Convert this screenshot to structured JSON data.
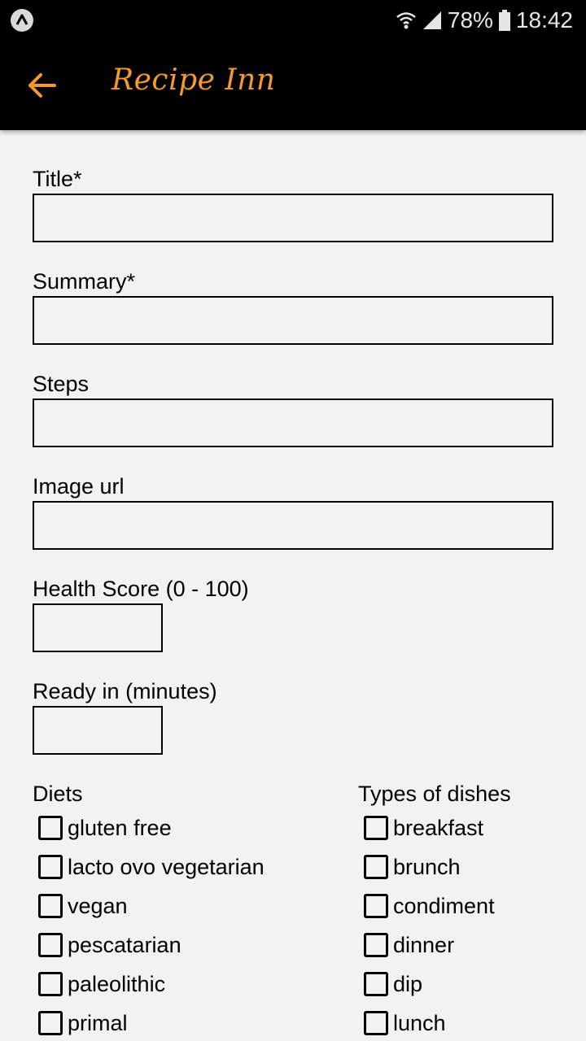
{
  "status_bar": {
    "app_icon": "app-launcher-icon",
    "battery_percent": "78%",
    "time": "18:42",
    "icons": [
      "wifi-icon",
      "signal-icon",
      "battery-icon"
    ]
  },
  "app_bar": {
    "back_icon": "arrow-left-icon",
    "title": "Recipe Inn",
    "accent_color": "#f39a2b"
  },
  "form": {
    "title_label": "Title*",
    "title_value": "",
    "summary_label": "Summary*",
    "summary_value": "",
    "steps_label": "Steps",
    "steps_value": "",
    "image_url_label": "Image url",
    "image_url_value": "",
    "health_score_label": "Health Score (0 - 100)",
    "health_score_value": "",
    "ready_in_label": "Ready in (minutes)",
    "ready_in_value": ""
  },
  "diets": {
    "heading": "Diets",
    "items": [
      {
        "label": "gluten free",
        "checked": false
      },
      {
        "label": "lacto ovo vegetarian",
        "checked": false
      },
      {
        "label": "vegan",
        "checked": false
      },
      {
        "label": "pescatarian",
        "checked": false
      },
      {
        "label": "paleolithic",
        "checked": false
      },
      {
        "label": "primal",
        "checked": false
      }
    ]
  },
  "dish_types": {
    "heading": "Types of dishes",
    "items": [
      {
        "label": "breakfast",
        "checked": false
      },
      {
        "label": "brunch",
        "checked": false
      },
      {
        "label": "condiment",
        "checked": false
      },
      {
        "label": "dinner",
        "checked": false
      },
      {
        "label": "dip",
        "checked": false
      },
      {
        "label": "lunch",
        "checked": false
      }
    ]
  }
}
